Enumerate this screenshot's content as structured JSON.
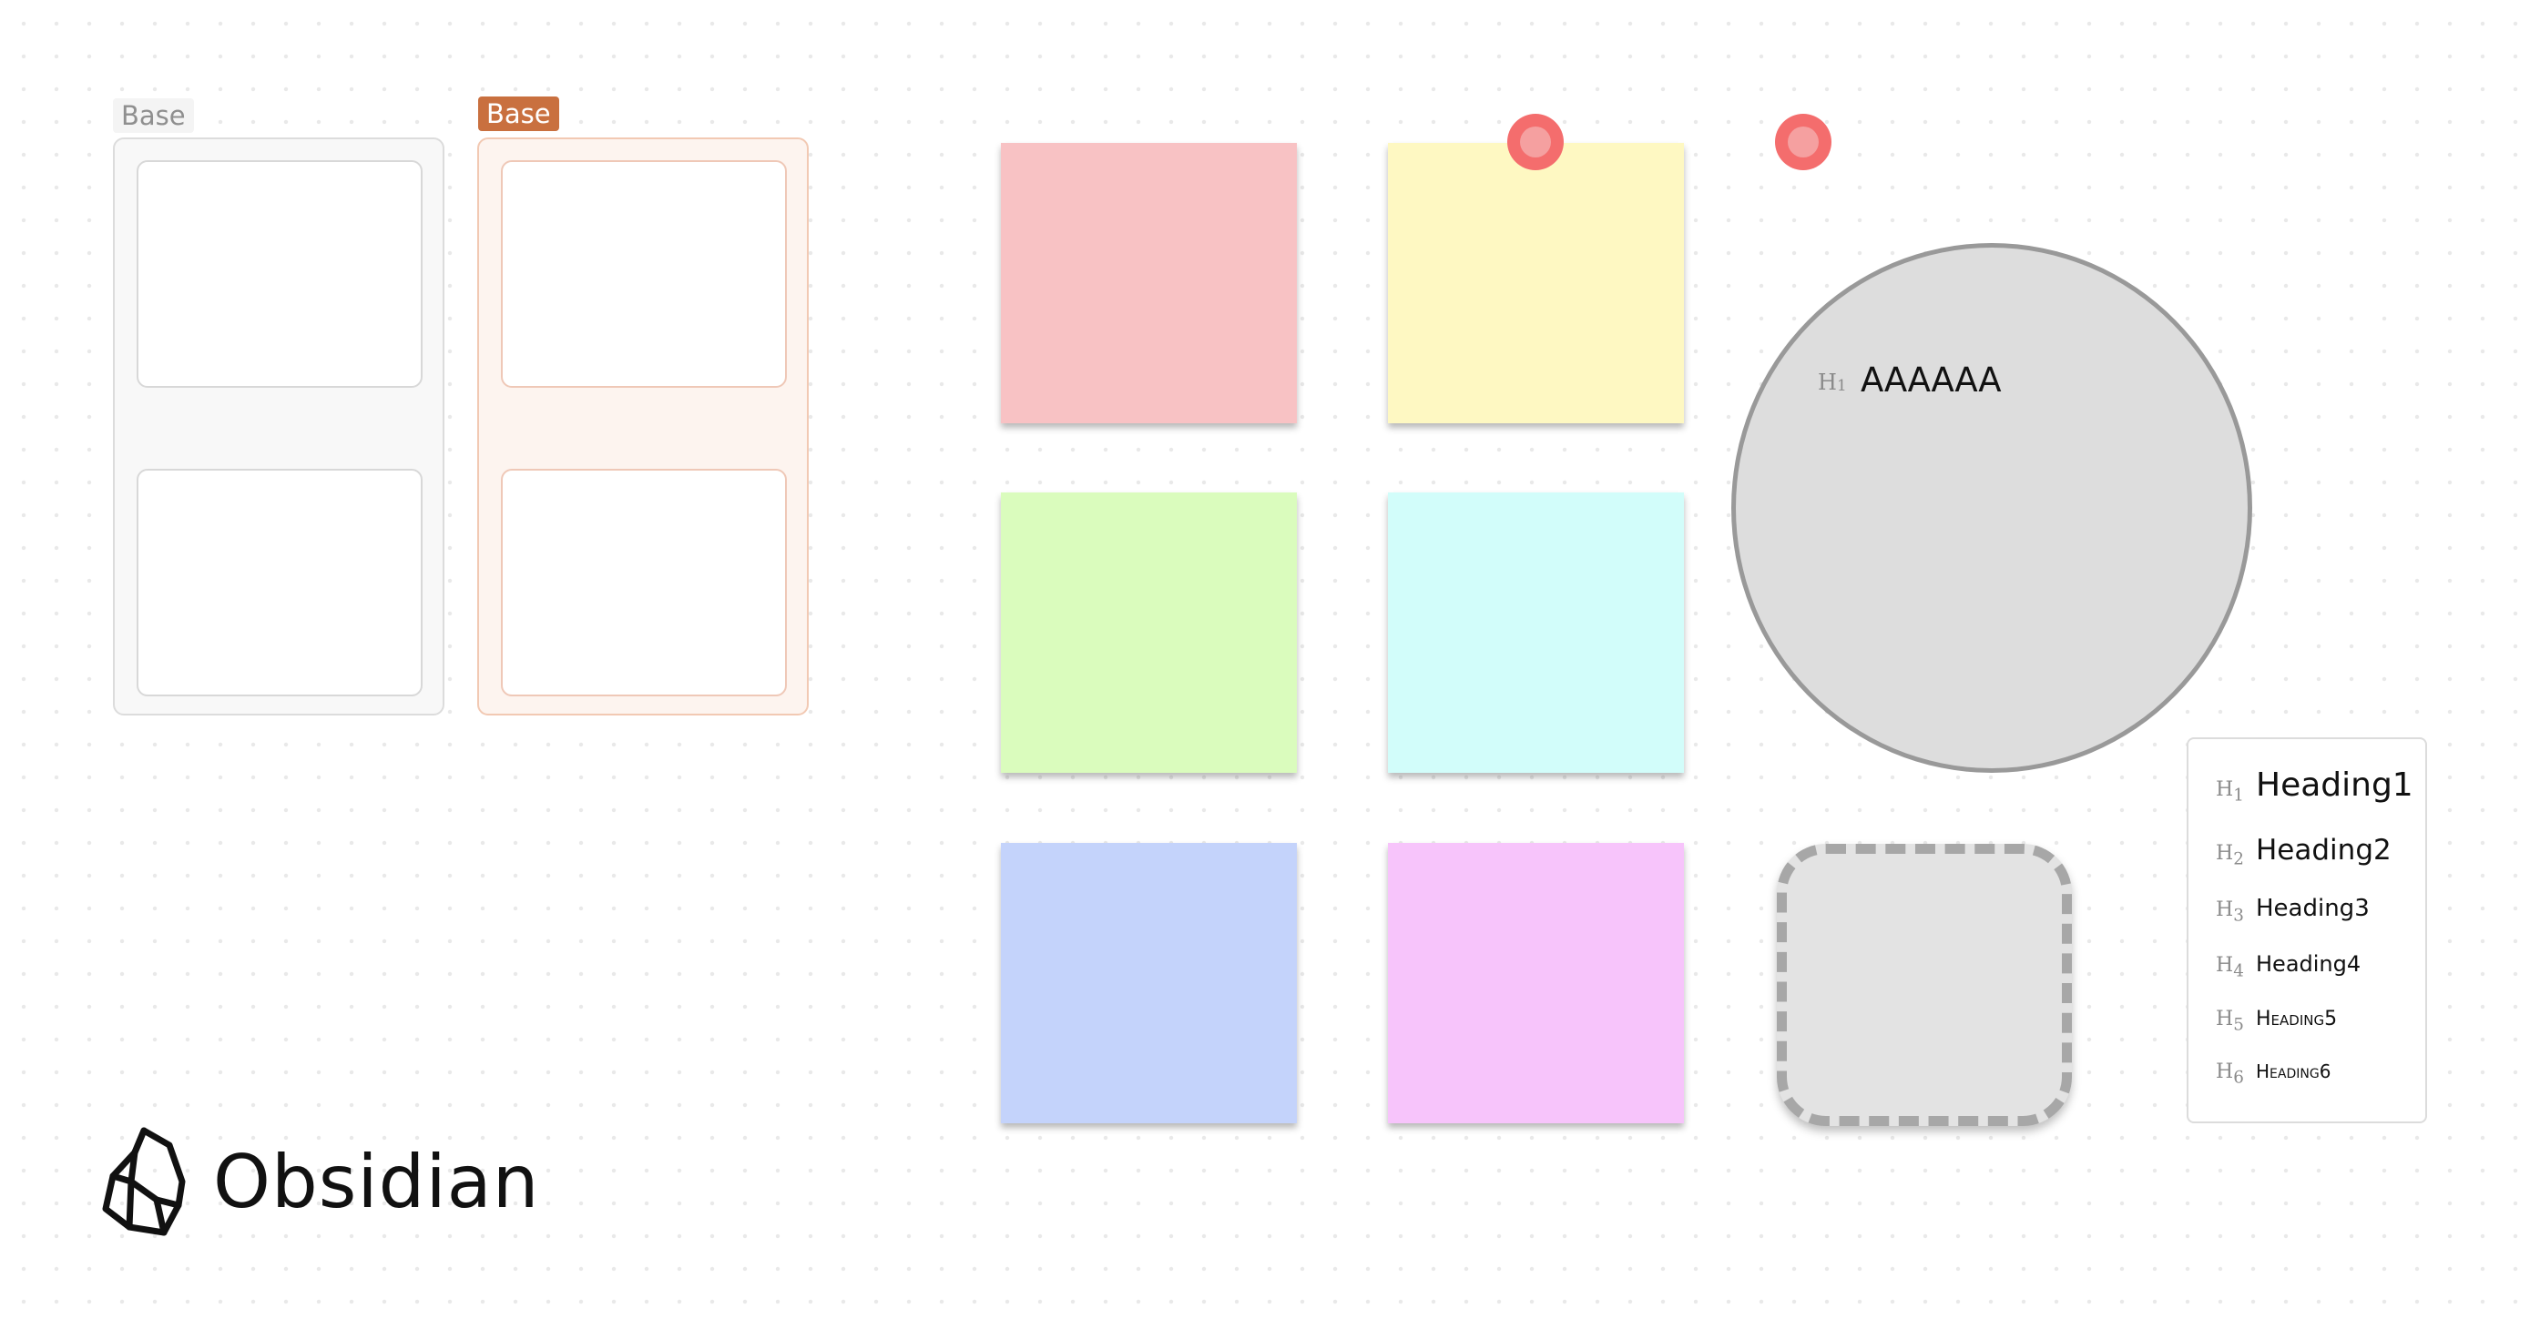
{
  "groups": [
    {
      "label": "Base",
      "style": "gray"
    },
    {
      "label": "Base",
      "style": "orange",
      "accent": "#c9703f"
    }
  ],
  "sticky_notes": {
    "colors": [
      "#f8c2c4",
      "#fef8c2",
      "#dafcbd",
      "#d2fdfa",
      "#c4d3fb",
      "#f7c4fb"
    ]
  },
  "circle_node": {
    "marker": "H",
    "marker_level": "1",
    "heading": "AAAAAA",
    "fill": "#dddddd",
    "border": "#999999"
  },
  "dashed_node": {
    "fill": "#e3e3e3",
    "border": "#a7a7a7"
  },
  "headings_card": {
    "rows": [
      {
        "marker": "H",
        "level": "1",
        "text": "Heading1"
      },
      {
        "marker": "H",
        "level": "2",
        "text": "Heading2"
      },
      {
        "marker": "H",
        "level": "3",
        "text": "Heading3"
      },
      {
        "marker": "H",
        "level": "4",
        "text": "Heading4"
      },
      {
        "marker": "H",
        "level": "5",
        "text": "Heading5"
      },
      {
        "marker": "H",
        "level": "6",
        "text": "Heading6"
      }
    ]
  },
  "pins": {
    "color": "#f46d6d"
  },
  "logo": {
    "icon": "obsidian-logo-icon",
    "text": "Obsidian"
  }
}
